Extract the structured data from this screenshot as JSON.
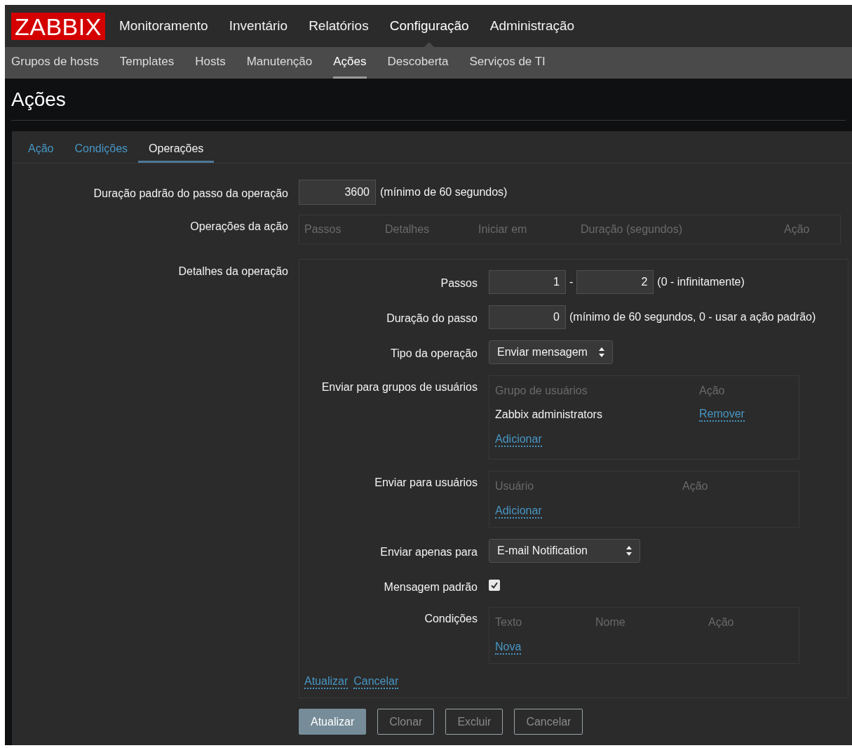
{
  "logo": "ZABBIX",
  "main_menu": [
    {
      "label": "Monitoramento",
      "selected": false
    },
    {
      "label": "Inventário",
      "selected": false
    },
    {
      "label": "Relatórios",
      "selected": false
    },
    {
      "label": "Configuração",
      "selected": true
    },
    {
      "label": "Administração",
      "selected": false
    }
  ],
  "sub_menu": [
    {
      "label": "Grupos de hosts",
      "selected": false
    },
    {
      "label": "Templates",
      "selected": false
    },
    {
      "label": "Hosts",
      "selected": false
    },
    {
      "label": "Manutenção",
      "selected": false
    },
    {
      "label": "Ações",
      "selected": true
    },
    {
      "label": "Descoberta",
      "selected": false
    },
    {
      "label": "Serviços de TI",
      "selected": false
    }
  ],
  "page_title": "Ações",
  "tabs": [
    {
      "label": "Ação",
      "selected": false
    },
    {
      "label": "Condições",
      "selected": false
    },
    {
      "label": "Operações",
      "selected": true
    }
  ],
  "form": {
    "default_duration": {
      "label": "Duração padrão do passo da operação",
      "value": "3600",
      "hint": "(mínimo de 60 segundos)"
    },
    "operations": {
      "label": "Operações da ação",
      "columns": [
        "Passos",
        "Detalhes",
        "Iniciar em",
        "Duração (segundos)",
        "Ação"
      ]
    },
    "details": {
      "label": "Detalhes da operação",
      "steps": {
        "label": "Passos",
        "from": "1",
        "separator": "-",
        "to": "2",
        "hint": "(0 - infinitamente)"
      },
      "step_duration": {
        "label": "Duração do passo",
        "value": "0",
        "hint": "(mínimo de 60 segundos, 0 - usar a ação padrão)"
      },
      "operation_type": {
        "label": "Tipo da operação",
        "value": "Enviar mensagem"
      },
      "user_groups": {
        "label": "Enviar para grupos de usuários",
        "columns": [
          "Grupo de usuários",
          "Ação"
        ],
        "rows": [
          {
            "name": "Zabbix administrators",
            "action": "Remover"
          }
        ],
        "add": "Adicionar"
      },
      "users": {
        "label": "Enviar para usuários",
        "columns": [
          "Usuário",
          "Ação"
        ],
        "add": "Adicionar"
      },
      "send_only_to": {
        "label": "Enviar apenas para",
        "value": "E-mail Notification"
      },
      "default_message": {
        "label": "Mensagem padrão",
        "checked": true
      },
      "conditions": {
        "label": "Condições",
        "columns": [
          "Texto",
          "Nome",
          "Ação"
        ],
        "add": "Nova"
      },
      "links": [
        "Atualizar",
        "Cancelar"
      ]
    }
  },
  "buttons": [
    {
      "label": "Atualizar",
      "kind": "primary"
    },
    {
      "label": "Clonar",
      "kind": "alt"
    },
    {
      "label": "Excluir",
      "kind": "alt"
    },
    {
      "label": "Cancelar",
      "kind": "alt"
    }
  ]
}
